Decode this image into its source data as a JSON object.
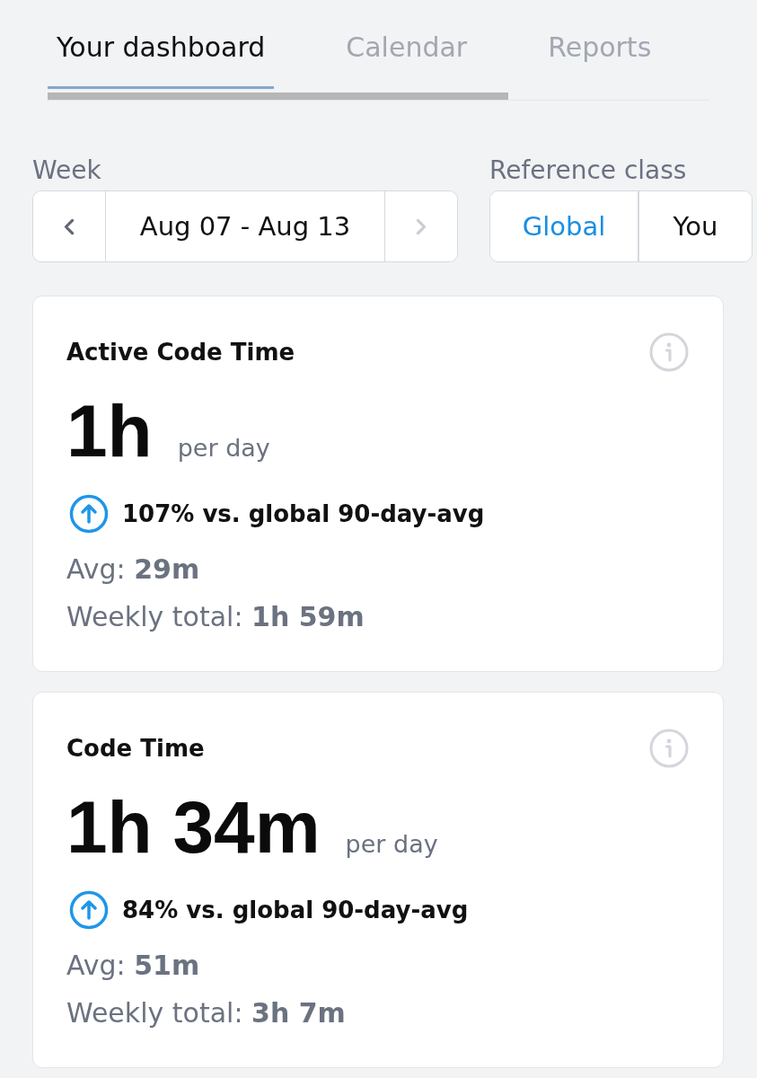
{
  "tabs": [
    {
      "label": "Your dashboard",
      "selected": true
    },
    {
      "label": "Calendar",
      "selected": false
    },
    {
      "label": "Reports",
      "selected": false
    }
  ],
  "week": {
    "label": "Week",
    "range": "Aug 07 - Aug 13",
    "prev": {
      "disabled": false
    },
    "next": {
      "disabled": true
    }
  },
  "reference_class": {
    "label": "Reference class",
    "options": [
      {
        "label": "Global",
        "selected": true
      },
      {
        "label": "You",
        "selected": false
      }
    ]
  },
  "cards": [
    {
      "title": "Active Code Time",
      "value": "1h",
      "unit": "per day",
      "trend": {
        "kind": "up",
        "text": "107% vs. global 90-day-avg"
      },
      "lines": [
        "Avg: **29m**",
        "Weekly total: **1h 59m**"
      ]
    },
    {
      "title": "Code Time",
      "value": "1h 34m",
      "unit": "per day",
      "trend": {
        "kind": "up",
        "text": "84% vs. global 90-day-avg"
      },
      "lines": [
        "Avg: **51m**",
        "Weekly total: **3h 7m**"
      ]
    }
  ]
}
